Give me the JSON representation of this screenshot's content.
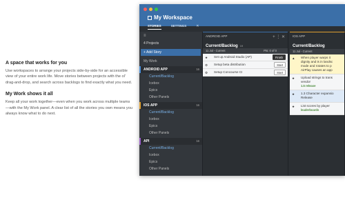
{
  "copy": {
    "h1": "A space that works for you",
    "p1": "Use workspaces to arrange your projects side-by-side for an accessible view of your entire work life. Move stories between projects with the ol' drag-and-drop, and search across backlogs to find exactly what you need.",
    "h2": "My Work shows it all",
    "p2": "Keep all your work together—even when you work across multiple teams—with the My Work panel. A clear list of all the stories you own means you always know what to do next."
  },
  "window": {
    "title": "My Workspace",
    "tabs": [
      "STORIES",
      "SETTINGS"
    ],
    "tab_close": "✕"
  },
  "sidebar": {
    "menu_icon": "≡",
    "projects_label": "4  Projects",
    "add_story": "+ Add Story",
    "my_work": "My Work",
    "groups": [
      {
        "name": "ANDROID APP",
        "count": "16",
        "color": "#4a8fd8",
        "items": [
          "Current/Backlog",
          "Icebox",
          "Epics",
          "Other Panels"
        ]
      },
      {
        "name": "IOS APP",
        "count": "16",
        "color": "#e0a030",
        "items": [
          "Current/Backlog",
          "Icebox",
          "Epics",
          "Other Panels"
        ]
      },
      {
        "name": "API",
        "count": "16",
        "color": "#9a5fc8",
        "items": [
          "Current/Backlog",
          "Icebox",
          "Epics",
          "Other Panels"
        ]
      }
    ]
  },
  "panel_android": {
    "project": "ANDROID APP",
    "title": "Current/Backlog",
    "count": "19",
    "tools": "+  ⋮  ✕",
    "iteration": "11 Jul - Current",
    "points": "Pts: 0 of 0",
    "stories": [
      {
        "icon": "★",
        "text": "Set up Android Studio (AP)",
        "button": "Finish",
        "dark": true
      },
      {
        "icon": "⚙",
        "text": "Setup beta distribution",
        "button": "Start",
        "dark": false
      },
      {
        "icon": "⚙",
        "text": "Setup Concourse CI",
        "button": "Start",
        "dark": false
      }
    ]
  },
  "panel_ios": {
    "project": "IOS APP",
    "title": "Current/Backlog",
    "iteration": "11 Jul - Current",
    "stories": [
      {
        "icon": "▲",
        "text": "When player warps it\ndignity and is in landsc\nmode and rotates to p\nAirPlay causes an app",
        "label": "",
        "style": "yellow"
      },
      {
        "icon": "★",
        "text": "Upload strings to trans\nvendor",
        "label": "1.5 release",
        "style": ""
      },
      {
        "icon": "★",
        "text": "1.3 Character expansio\nRelease",
        "label": "",
        "style": "blue"
      },
      {
        "icon": "★",
        "text": "List scores by player",
        "label": "leaderboards",
        "style": ""
      }
    ]
  }
}
